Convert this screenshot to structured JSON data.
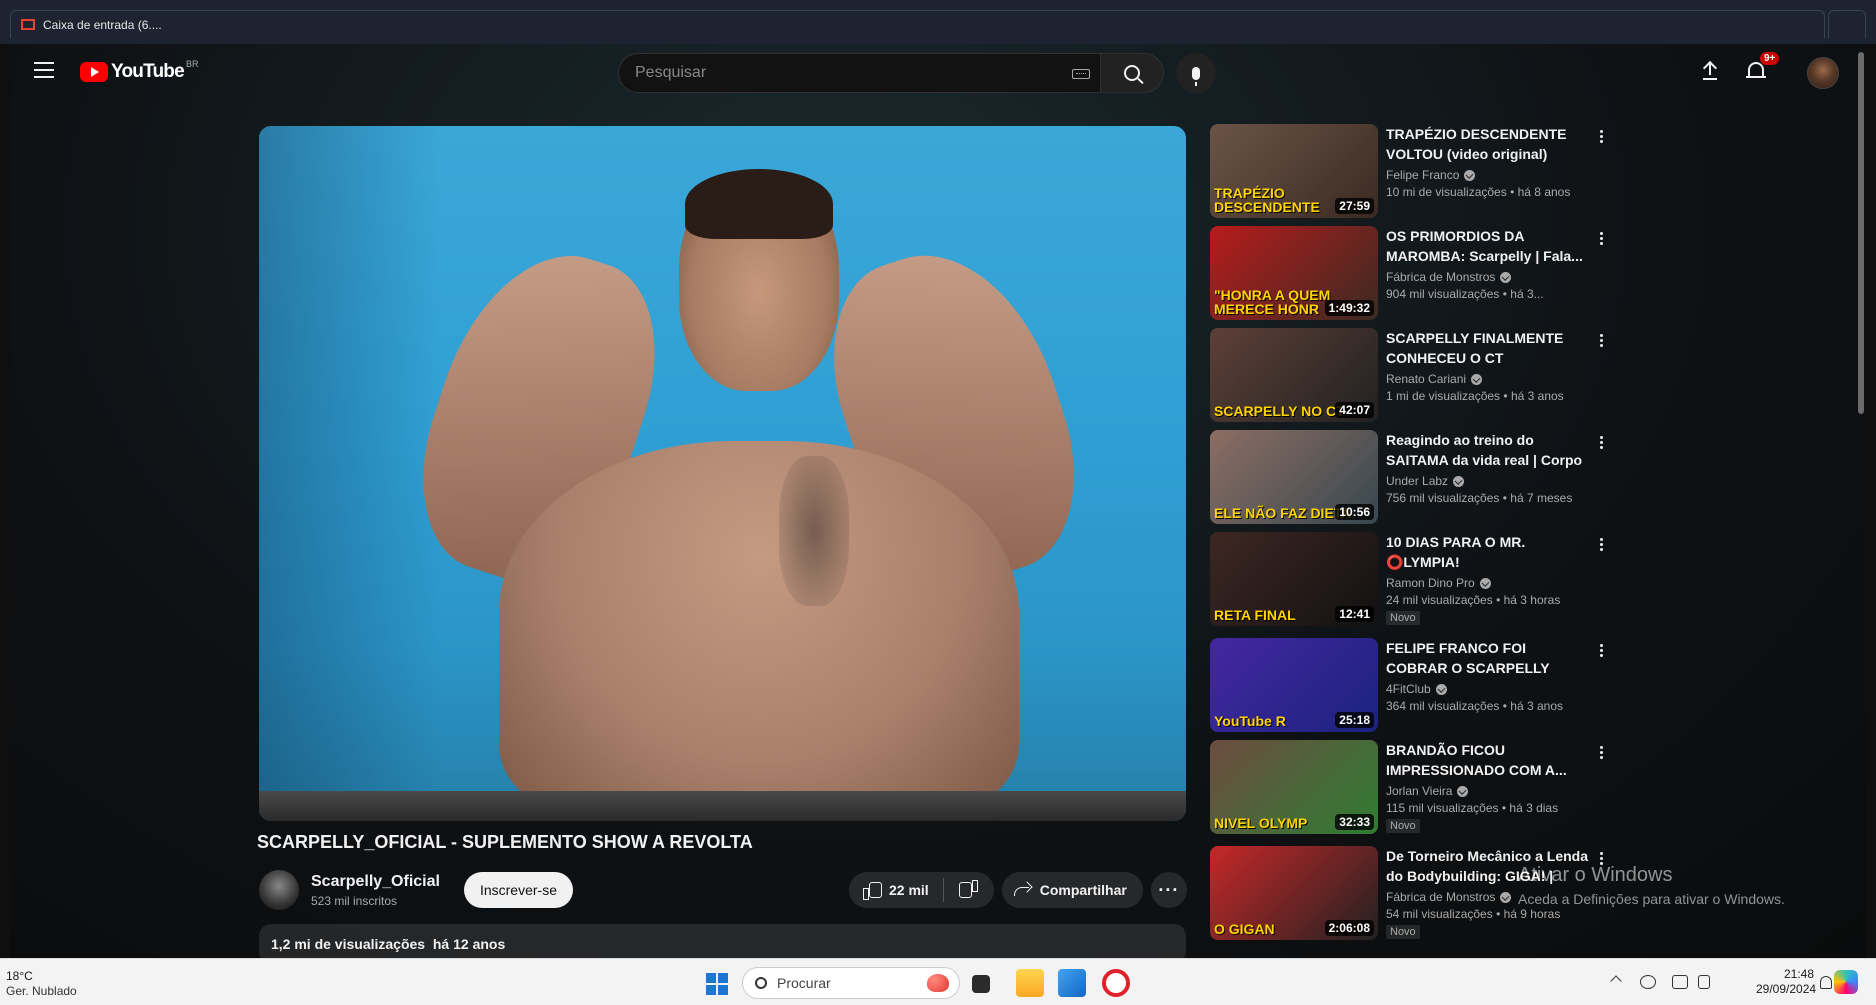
{
  "browser": {
    "tab_title": "Caixa de entrada (6...."
  },
  "masthead": {
    "logo_text": "YouTube",
    "country_code": "BR",
    "search_placeholder": "Pesquisar",
    "notification_count": "9+"
  },
  "video": {
    "title": "SCARPELLY_OFICIAL - SUPLEMENTO SHOW A REVOLTA",
    "channel_name": "Scarpelly_Oficial",
    "subscribers": "523 mil inscritos",
    "subscribe_label": "Inscrever-se",
    "likes": "22 mil",
    "share_label": "Compartilhar",
    "more_label": "···",
    "views": "1,2 mi de visualizações",
    "age": "há 12 anos"
  },
  "recommendations": [
    {
      "title": "TRAPÉZIO DESCENDENTE VOLTOU (video original)",
      "channel": "Felipe Franco",
      "views": "10 mi de visualizações",
      "age": "há 8 anos",
      "duration": "27:59",
      "thumb_text": "TRAPÉZIO DESCENDENTE",
      "badge": ""
    },
    {
      "title": "OS PRIMORDIOS DA MAROMBA: Scarpelly | Fala...",
      "channel": "Fábrica de Monstros",
      "views": "904 mil visualizações",
      "age": "há 3...",
      "duration": "1:49:32",
      "thumb_text": "\"HONRA A QUEM MERECE HONR",
      "badge": ""
    },
    {
      "title": "SCARPELLY FINALMENTE CONHECEU O CT",
      "channel": "Renato Cariani",
      "views": "1 mi de visualizações",
      "age": "há 3 anos",
      "duration": "42:07",
      "thumb_text": "SCARPELLY NO CT",
      "badge": ""
    },
    {
      "title": "Reagindo ao treino do SAITAMA da vida real | Corpo Definido...",
      "channel": "Under Labz",
      "views": "756 mil visualizações",
      "age": "há 7 meses",
      "duration": "10:56",
      "thumb_text": "ELE NÃO FAZ DIETA",
      "badge": ""
    },
    {
      "title": "10 DIAS PARA O MR. ⭕LYMPIA!",
      "channel": "Ramon Dino Pro",
      "views": "24 mil visualizações",
      "age": "há 3 horas",
      "duration": "12:41",
      "thumb_text": "RETA FINAL",
      "badge": "Novo"
    },
    {
      "title": "FELIPE FRANCO FOI COBRAR O SCARPELLY",
      "channel": "4FitClub",
      "views": "364 mil visualizações",
      "age": "há 3 anos",
      "duration": "25:18",
      "thumb_text": "YouTube R",
      "badge": ""
    },
    {
      "title": "BRANDÃO FICOU IMPRESSIONADO COM A...",
      "channel": "Jorlan Vieira",
      "views": "115 mil visualizações",
      "age": "há 3 dias",
      "duration": "32:33",
      "thumb_text": "NIVEL OLYMP",
      "badge": "Novo"
    },
    {
      "title": "De Torneiro Mecânico a Lenda do Bodybuilding: GIGA! | Fala...",
      "channel": "Fábrica de Monstros",
      "views": "54 mil visualizações",
      "age": "há 9 horas",
      "duration": "2:06:08",
      "thumb_text": "O GIGAN",
      "badge": "Novo"
    }
  ],
  "watermark": {
    "line1": "Ativar o Windows",
    "line2": "Aceda a Definições para ativar o Windows."
  },
  "taskbar": {
    "temperature": "18°C",
    "weather": "Ger. Nublado",
    "search_label": "Procurar",
    "time": "21:48",
    "date": "29/09/2024"
  },
  "colors": {
    "youtube_red": "#ff0000",
    "background": "#0f0f0f",
    "video_wall": "#2f9fd3"
  }
}
